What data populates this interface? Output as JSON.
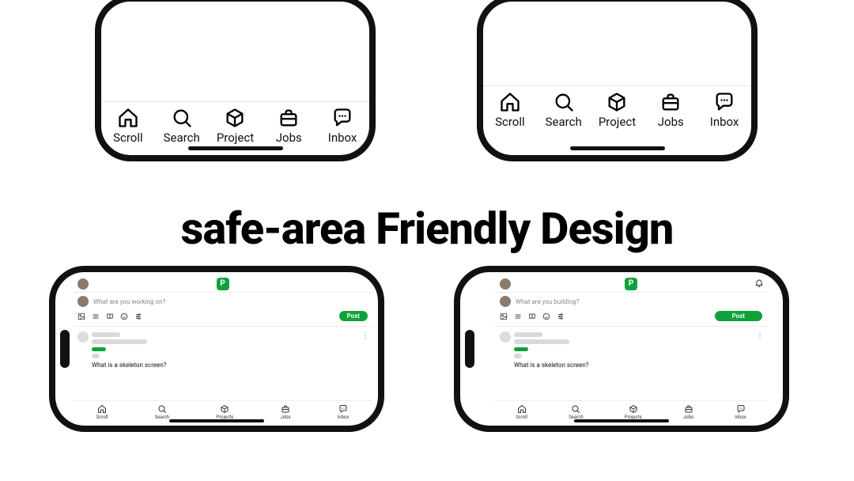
{
  "title": "safe-area Friendly Design",
  "tabs": {
    "big": [
      {
        "icon": "home",
        "label": "Scroll"
      },
      {
        "icon": "search",
        "label": "Search"
      },
      {
        "icon": "cube",
        "label": "Project"
      },
      {
        "icon": "briefcase",
        "label": "Jobs"
      },
      {
        "icon": "chat",
        "label": "Inbox"
      }
    ],
    "mini": [
      {
        "icon": "home",
        "label": "Scroll"
      },
      {
        "icon": "search",
        "label": "Search"
      },
      {
        "icon": "cube",
        "label": "Projects"
      },
      {
        "icon": "briefcase",
        "label": "Jobs"
      },
      {
        "icon": "chat",
        "label": "Inbox"
      }
    ]
  },
  "composer": {
    "placeholder_left": "What are you working on?",
    "placeholder_right": "What are you building?",
    "post": "Post"
  },
  "feed": {
    "text": "What is a skeleton screen?"
  },
  "logo_letter": "P"
}
